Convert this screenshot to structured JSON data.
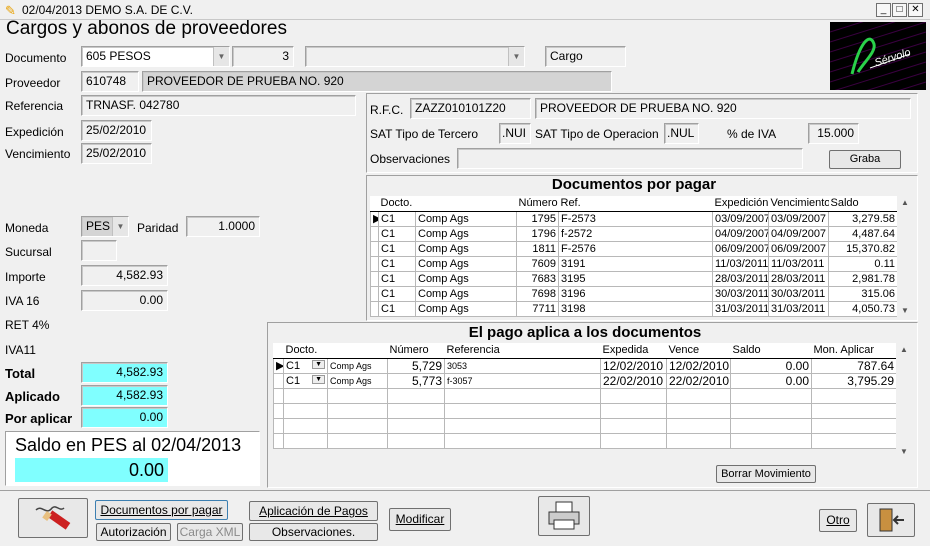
{
  "window": {
    "title": "02/04/2013  DEMO  S.A. DE C.V.",
    "buttons": {
      "minimize": "_",
      "maximize": "□",
      "close": "✕"
    }
  },
  "form": {
    "title": "Cargos y abonos de proveedores",
    "documento": {
      "label": "Documento",
      "value": "605 PESOS",
      "number": "3",
      "tipo": "Cargo"
    },
    "proveedor": {
      "label": "Proveedor",
      "code": "610748",
      "name": "PROVEEDOR DE PRUEBA NO. 920"
    },
    "referencia": {
      "label": "Referencia",
      "value": "TRNASF. 042780"
    },
    "expedicion": {
      "label": "Expedición",
      "value": "25/02/2010"
    },
    "vencimiento": {
      "label": "Vencimiento",
      "value": "25/02/2010"
    },
    "moneda": {
      "label": "Moneda",
      "value": "PES"
    },
    "paridad": {
      "label": "Paridad",
      "value": "1.0000"
    },
    "sucursal": {
      "label": "Sucursal",
      "value": ""
    },
    "importe": {
      "label": "Importe",
      "value": "4,582.93"
    },
    "iva16": {
      "label": "IVA 16",
      "value": "0.00"
    },
    "ret4": {
      "label": "RET 4%"
    },
    "iva11": {
      "label": "IVA11"
    },
    "total": {
      "label": "Total",
      "value": "4,582.93"
    },
    "aplicado": {
      "label": "Aplicado",
      "value": "4,582.93"
    },
    "por_aplicar": {
      "label": "Por aplicar",
      "value": "0.00"
    },
    "saldo": {
      "label": "Saldo en PES al 02/04/2013",
      "value": "0.00"
    }
  },
  "supplier_info": {
    "rfc_label": "R.F.C.",
    "rfc": "ZAZZ010101Z20",
    "name": "PROVEEDOR DE PRUEBA NO. 920",
    "sat_tercero_label": "SAT Tipo de Tercero",
    "sat_tercero": ".NUI",
    "sat_operacion_label": "SAT Tipo de Operacion",
    "sat_operacion": ".NUL",
    "iva_label": "% de IVA",
    "iva": "15.000",
    "observaciones_label": "Observaciones",
    "observaciones": "",
    "graba_label": "Graba"
  },
  "docs_por_pagar": {
    "title": "Documentos por pagar",
    "columns": [
      "Docto.",
      "",
      "Número",
      "Ref.",
      "Expedición",
      "Vencimiento",
      "Saldo"
    ],
    "rows": [
      [
        "C1",
        "Comp Ags",
        "1795",
        "F-2573",
        "03/09/2007",
        "03/09/2007",
        "3,279.58"
      ],
      [
        "C1",
        "Comp Ags",
        "1796",
        "f-2572",
        "04/09/2007",
        "04/09/2007",
        "4,487.64"
      ],
      [
        "C1",
        "Comp Ags",
        "1811",
        "F-2576",
        "06/09/2007",
        "06/09/2007",
        "15,370.82"
      ],
      [
        "C1",
        "Comp Ags",
        "7609",
        "3191",
        "11/03/2011",
        "11/03/2011",
        "0.11"
      ],
      [
        "C1",
        "Comp Ags",
        "7683",
        "3195",
        "28/03/2011",
        "28/03/2011",
        "2,981.78"
      ],
      [
        "C1",
        "Comp Ags",
        "7698",
        "3196",
        "30/03/2011",
        "30/03/2011",
        "315.06"
      ],
      [
        "C1",
        "Comp Ags",
        "7711",
        "3198",
        "31/03/2011",
        "31/03/2011",
        "4,050.73"
      ]
    ]
  },
  "pago_aplica": {
    "title": "El pago aplica a los documentos",
    "columns": [
      "Docto.",
      "",
      "Número",
      "Referencia",
      "Expedida",
      "Vence",
      "Saldo",
      "Mon. Aplicar"
    ],
    "rows": [
      [
        "C1",
        "Comp Ags",
        "5,729",
        "3053",
        "12/02/2010",
        "12/02/2010",
        "0.00",
        "787.64"
      ],
      [
        "C1",
        "Comp Ags",
        "5,773",
        "f-3057",
        "22/02/2010",
        "22/02/2010",
        "0.00",
        "3,795.29"
      ]
    ],
    "borrar_label": "Borrar Movimiento"
  },
  "toolbar": {
    "docs_por_pagar": "Documentos por pagar",
    "autorizacion": "Autorización",
    "carga_xml": "Carga XML",
    "aplicacion_pagos": "Aplicación de Pagos",
    "observaciones": "Observaciones.",
    "modificar": "Modificar",
    "otro": "Otro"
  },
  "logo": {
    "text": "Sérvolo"
  },
  "colors": {
    "highlight_field": "#80ffff",
    "logo_bg": "#000000",
    "logo_accent": "#cc00cc"
  }
}
